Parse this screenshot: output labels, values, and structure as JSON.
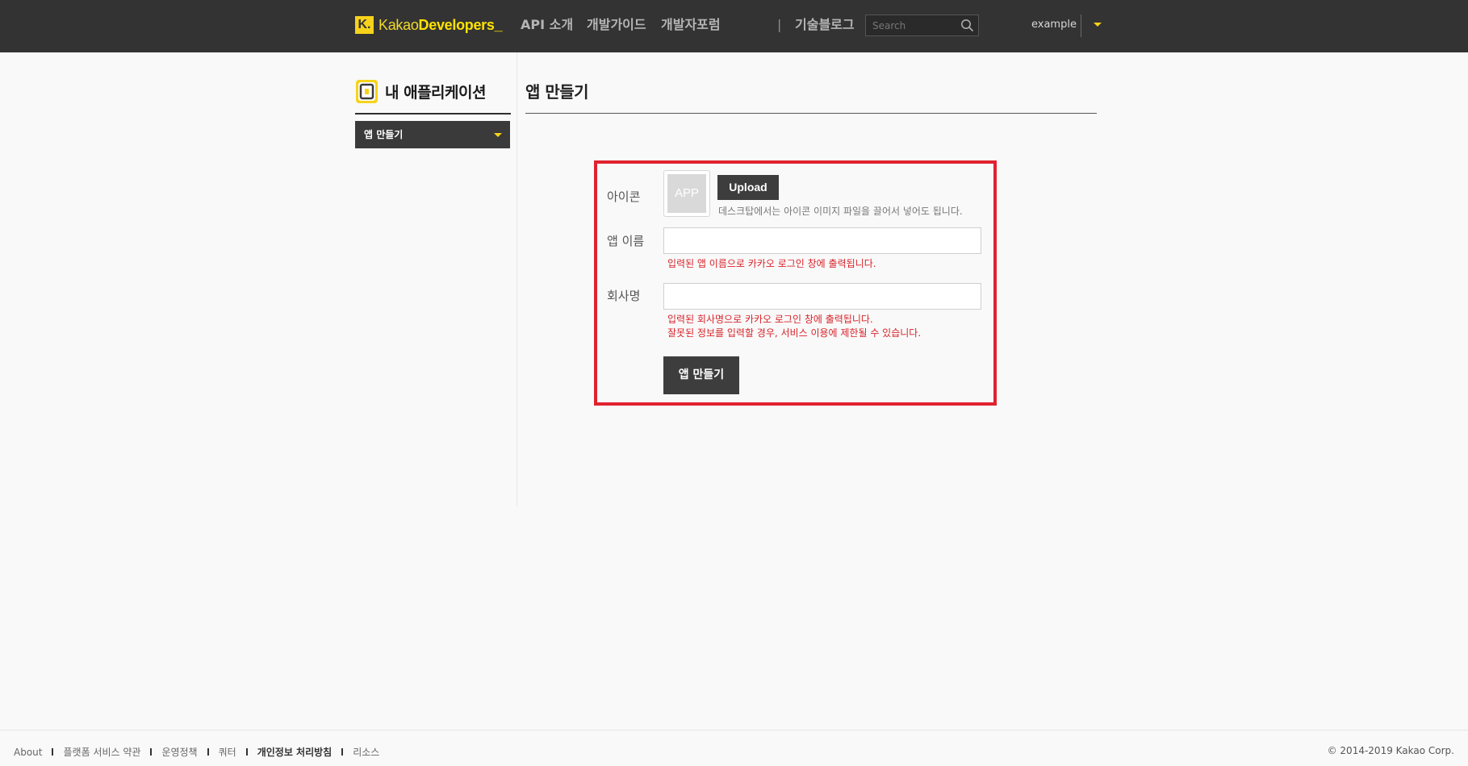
{
  "header": {
    "logo_k": "K.",
    "logo_kakao": "Kakao",
    "logo_developers": "Developers_",
    "nav": [
      "API 소개",
      "개발가이드",
      "개발자포럼"
    ],
    "divider": "|",
    "blog": "기술블로그",
    "search_placeholder": "Search",
    "user": "example",
    "accent": "#f7d21a"
  },
  "sidebar": {
    "title": "내 애플리케이션",
    "select_value": "앱 만들기"
  },
  "main": {
    "title": "앱 만들기",
    "form": {
      "icon_label": "아이콘",
      "icon_placeholder": "APP",
      "upload_label": "Upload",
      "upload_hint": "데스크탑에서는 아이콘 이미지 파일을 끌어서 넣어도 됩니다.",
      "app_name_label": "앱 이름",
      "app_name_value": "",
      "app_name_note": "입력된 앱 이름으로 카카오 로그인 창에 출력됩니다.",
      "company_label": "회사명",
      "company_value": "",
      "company_note_1": "입력된 회사명으로 카카오 로그인 창에 출력됩니다.",
      "company_note_2": "잘못된 정보를 입력할 경우, 서비스 이용에 제한될 수 있습니다.",
      "submit_label": "앱 만들기"
    },
    "highlight_color": "#e0222f"
  },
  "footer": {
    "links": [
      "About",
      "플랫폼 서비스 약관",
      "운영정책",
      "쿼터",
      "개인정보 처리방침",
      "리소스"
    ],
    "copyright": "© 2014-2019 Kakao Corp."
  }
}
